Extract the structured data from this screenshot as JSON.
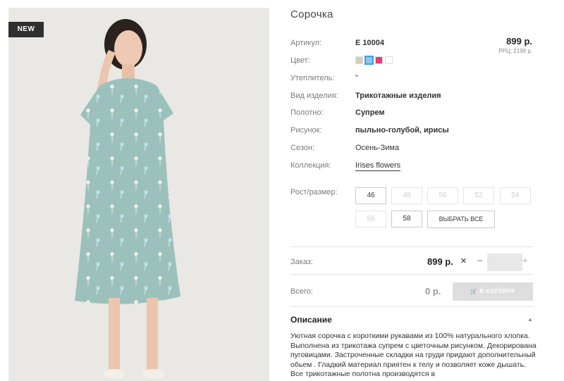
{
  "product": {
    "badge": "NEW",
    "title": "Сорочка",
    "price": "899 р.",
    "rrc": "РРЦ: 2199 р."
  },
  "colors": {
    "swatches": [
      "#d8ccb4",
      "#8ec7ee",
      "#e93b79",
      "#ffffff"
    ],
    "selected_index": 1,
    "accent": "#3aa0e6"
  },
  "attributes": {
    "article": {
      "label": "Артикул:",
      "value": "E 10004"
    },
    "color": {
      "label": "Цвет:"
    },
    "insulation": {
      "label": "Утеплитель:",
      "value": "\""
    },
    "type": {
      "label": "Вид изделия:",
      "value": "Трикотажные изделия"
    },
    "fabric": {
      "label": "Полотно:",
      "value": "Супрем"
    },
    "pattern": {
      "label": "Рисунок:",
      "value": "пыльно-голубой, ирисы"
    },
    "season": {
      "label": "Сезон:",
      "value": "Осень-Зима"
    },
    "collection": {
      "label": "Коллекция:",
      "value": "Irises flowers"
    }
  },
  "sizes": {
    "label": "Рост/размер:",
    "items": [
      {
        "value": "46",
        "available": true
      },
      {
        "value": "48",
        "available": false
      },
      {
        "value": "50",
        "available": false
      },
      {
        "value": "52",
        "available": false
      },
      {
        "value": "54",
        "available": false
      },
      {
        "value": "56",
        "available": false
      },
      {
        "value": "58",
        "available": true
      }
    ],
    "select_all": "ВЫБРАТЬ ВСЕ"
  },
  "order": {
    "label": "Заказ:",
    "price": "899 р.",
    "times": "×",
    "minus": "−",
    "plus": "+"
  },
  "total": {
    "label": "Всего:",
    "value": "0 р.",
    "cart_button": "В КОРЗИНУ"
  },
  "description": {
    "title": "Описание",
    "text": "Уютная сорочка с короткими рукавами из 100% натурального хлопка. Выполнена из трикотажа супрем с цветочным рисунком. Декорирована пуговицами. Застроченные складки на груди придают дополнительный обьем . Гладкий материал приятен к телу и позволяет коже дышать. Все трикотажные полотна производятся в"
  }
}
